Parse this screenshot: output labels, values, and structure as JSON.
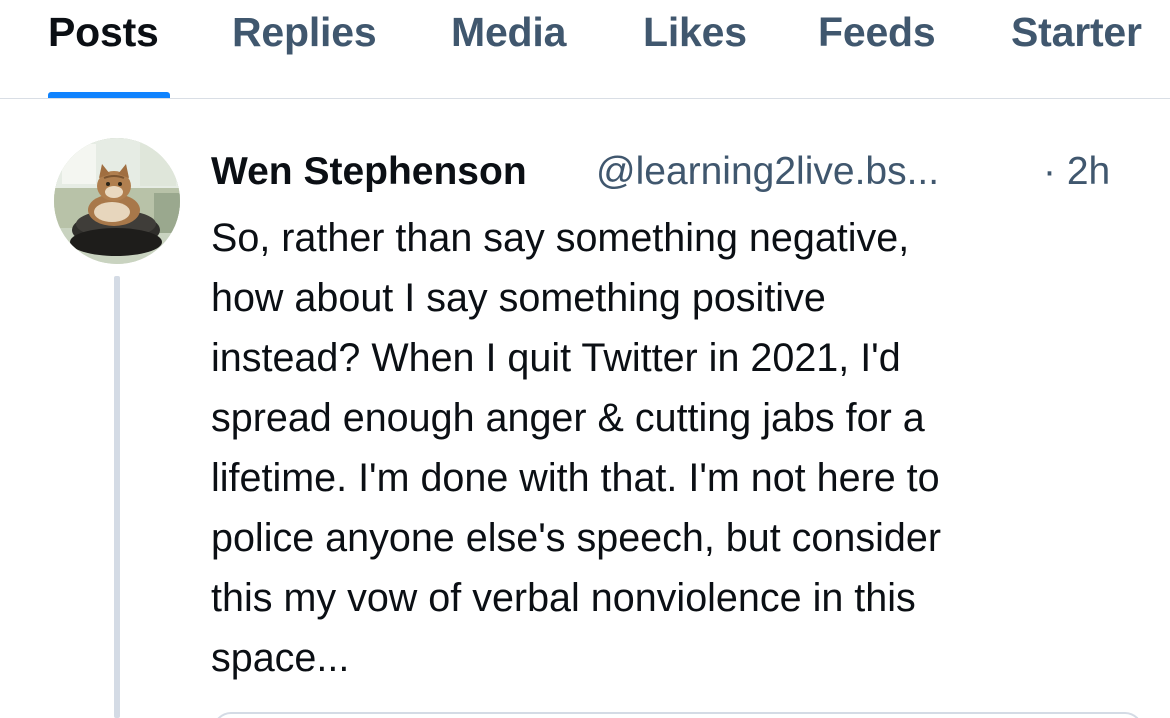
{
  "tabs": [
    {
      "label": "Posts",
      "active": true
    },
    {
      "label": "Replies",
      "active": false
    },
    {
      "label": "Media",
      "active": false
    },
    {
      "label": "Likes",
      "active": false
    },
    {
      "label": "Feeds",
      "active": false
    },
    {
      "label": "Starter",
      "active": false
    }
  ],
  "colors": {
    "active_tab_underline": "#1083fe",
    "muted_text": "#40576e",
    "primary_text": "#0b0f14",
    "thread_line": "#d4dbe5"
  },
  "post": {
    "author_name": "Wen Stephenson",
    "author_handle": "@learning2live.bs...",
    "time": "· 2h",
    "avatar": "cat-avatar",
    "text": "So, rather than say something negative,\nhow about I say something positive\ninstead? When I quit Twitter in 2021, I'd\nspread enough anger & cutting jabs for a\nlifetime. I'm done with that. I'm not here to\npolice anyone else's speech, but consider\nthis my vow of verbal nonviolence in this\nspace..."
  }
}
